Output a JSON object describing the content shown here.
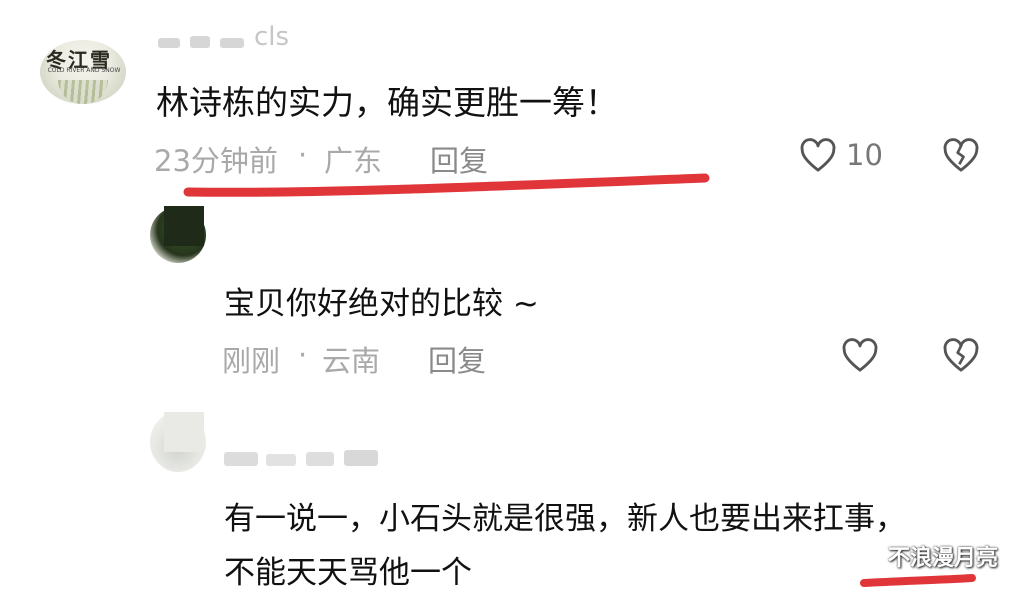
{
  "comments": [
    {
      "username": "",
      "username_partial": "cls",
      "avatar_logo": "冬江雪",
      "avatar_sub": "COLD RIVER AND SNOW",
      "text": "林诗栋的实力，确实更胜一筹！",
      "time": "23分钟前",
      "separator": "·",
      "location": "广东",
      "reply_label": "回复",
      "likes": "10"
    },
    {
      "text": "宝贝你好绝对的比较 ~",
      "time": "刚刚",
      "separator": "·",
      "location": "云南",
      "reply_label": "回复"
    },
    {
      "line1": "有一说一，小石头就是很强，新人也要出来扛事，",
      "line2": "不能天天骂他一个"
    }
  ],
  "watermark": "不浪漫月亮",
  "colors": {
    "underline": "#e0363a",
    "text": "#111111",
    "meta": "#a9a9a9"
  },
  "icons": [
    "heart-icon",
    "broken-heart-icon"
  ]
}
